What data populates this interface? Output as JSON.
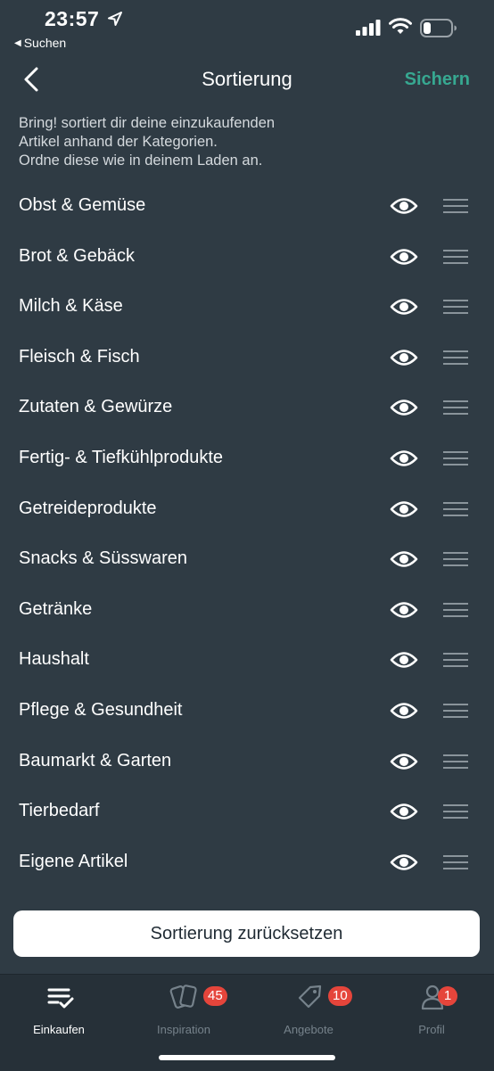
{
  "status": {
    "time": "23:57",
    "back_app": "Suchen"
  },
  "nav": {
    "title": "Sortierung",
    "save_label": "Sichern",
    "accent": "#37a891"
  },
  "intro": {
    "lines": [
      "Bring! sortiert dir deine einzukaufenden",
      "Artikel anhand der Kategorien.",
      "Ordne diese wie in deinem Laden an."
    ]
  },
  "categories": [
    {
      "label": "Obst & Gemüse"
    },
    {
      "label": "Brot & Gebäck"
    },
    {
      "label": "Milch & Käse"
    },
    {
      "label": "Fleisch & Fisch"
    },
    {
      "label": "Zutaten & Gewürze"
    },
    {
      "label": "Fertig- & Tiefkühlprodukte"
    },
    {
      "label": "Getreideprodukte"
    },
    {
      "label": "Snacks & Süsswaren"
    },
    {
      "label": "Getränke"
    },
    {
      "label": "Haushalt"
    },
    {
      "label": "Pflege & Gesundheit"
    },
    {
      "label": "Baumarkt & Garten"
    },
    {
      "label": "Tierbedarf"
    },
    {
      "label": "Eigene Artikel"
    }
  ],
  "reset_label": "Sortierung zurücksetzen",
  "tabbar": {
    "tabs": [
      {
        "label": "Einkaufen",
        "icon": "list-check-icon",
        "active": true
      },
      {
        "label": "Inspiration",
        "icon": "cards-icon",
        "badge": "45"
      },
      {
        "label": "Angebote",
        "icon": "tag-icon",
        "badge": "10"
      },
      {
        "label": "Profil",
        "icon": "profile-icon",
        "badge": "1"
      }
    ],
    "badge_color": "#e5453b"
  }
}
